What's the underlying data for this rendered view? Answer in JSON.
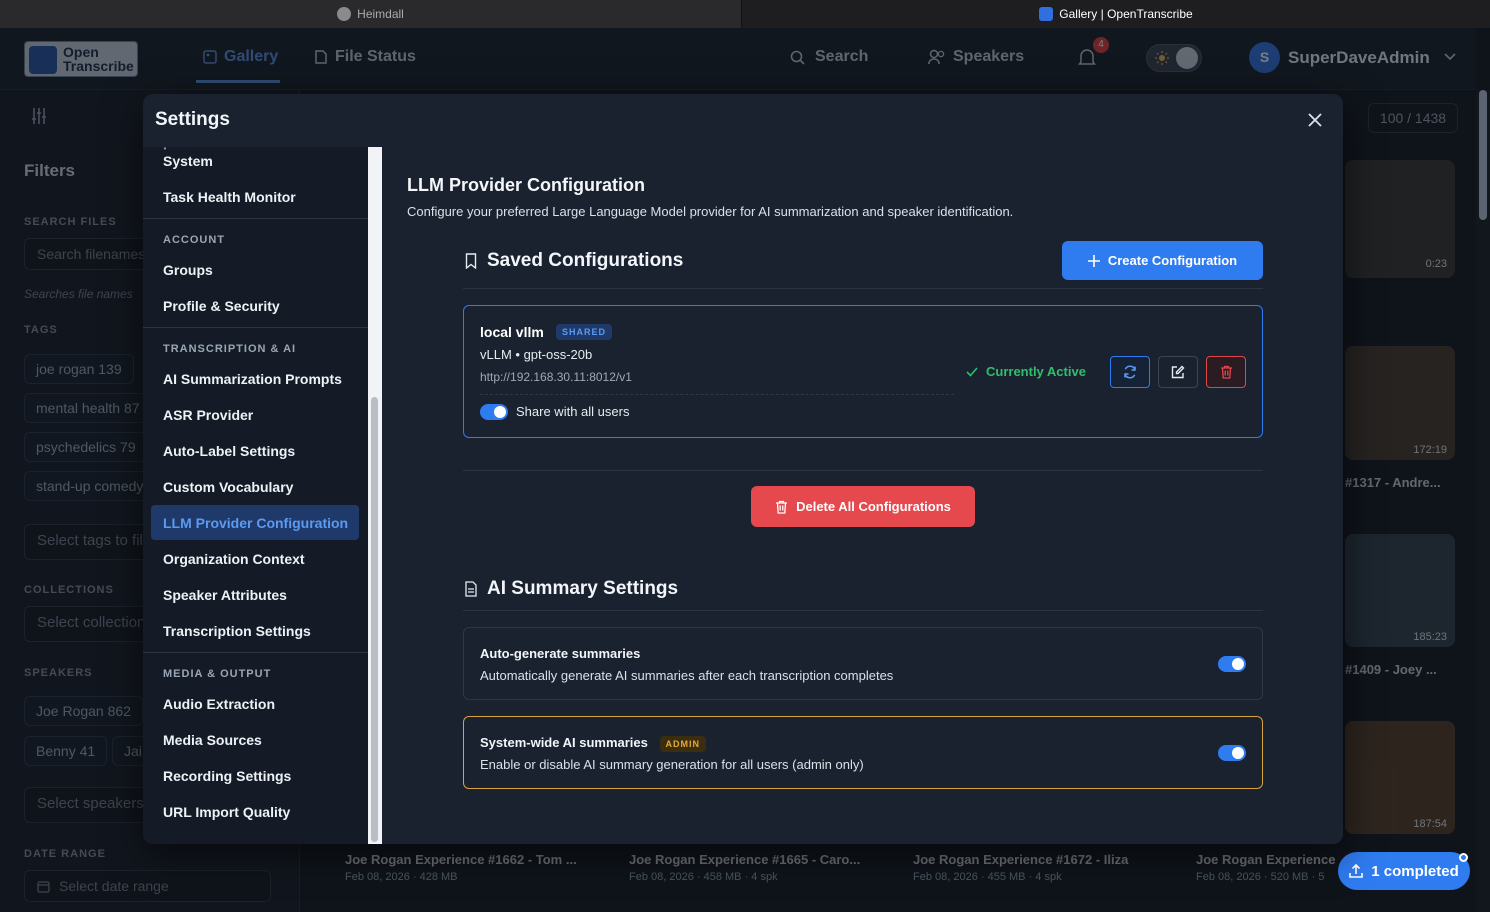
{
  "browser": {
    "tabs": [
      {
        "label": "Heimdall"
      },
      {
        "label": "Gallery | OpenTranscribe"
      }
    ]
  },
  "topnav": {
    "logo_text": "Open Transcribe",
    "gallery_label": "Gallery",
    "file_status_label": "File Status",
    "search_label": "Search",
    "speakers_label": "Speakers",
    "notification_count": "4",
    "avatar_initial": "S",
    "user_name": "SuperDaveAdmin"
  },
  "filters": {
    "title": "Filters",
    "search_files_label": "SEARCH FILES",
    "search_placeholder": "Search filenames",
    "search_hint": "Searches file names",
    "tags_label": "TAGS",
    "tags": [
      "joe rogan 139",
      "mental health 87",
      "psychedelics 79",
      "stand-up comedy"
    ],
    "select_tags": "Select tags to filter",
    "collections_label": "COLLECTIONS",
    "select_collections": "Select collections",
    "speakers_label": "SPEAKERS",
    "speakers": [
      "Joe Rogan 862",
      "Benny 41",
      "Jai"
    ],
    "select_speakers": "Select speakers",
    "date_range_label": "DATE RANGE",
    "date_placeholder": "Select date range"
  },
  "gallery": {
    "count": "100 / 1438",
    "thumbs": [
      {
        "duration": "0:23"
      },
      {
        "duration": "172:19",
        "title": "#1317 - Andre..."
      },
      {
        "duration": "185:23",
        "title": "#1409 - Joey ..."
      },
      {
        "duration": "187:54"
      }
    ],
    "bottom_items": [
      {
        "title": "Joe Rogan Experience #1662 - Tom ...",
        "meta": "Feb 08, 2026 · 428 MB"
      },
      {
        "title": "Joe Rogan Experience #1665 - Caro...",
        "meta": "Feb 08, 2026 · 458 MB · 4 spk"
      },
      {
        "title": "Joe Rogan Experience #1672 - Iliza",
        "meta": "Feb 08, 2026 · 455 MB · 4 spk"
      },
      {
        "title": "Joe Rogan Experience",
        "meta": "Feb 08, 2026 · 520 MB · 5"
      }
    ],
    "completed_label": "1 completed"
  },
  "settings": {
    "title": "Settings",
    "sidebar": {
      "top_items": [
        "System",
        "Task Health Monitor"
      ],
      "groups": [
        {
          "label": "ACCOUNT",
          "items": [
            "Groups",
            "Profile & Security"
          ]
        },
        {
          "label": "TRANSCRIPTION & AI",
          "items": [
            "AI Summarization Prompts",
            "ASR Provider",
            "Auto-Label Settings",
            "Custom Vocabulary",
            "LLM Provider Configuration",
            "Organization Context",
            "Speaker Attributes",
            "Transcription Settings"
          ]
        },
        {
          "label": "MEDIA & OUTPUT",
          "items": [
            "Audio Extraction",
            "Media Sources",
            "Recording Settings",
            "URL Import Quality"
          ]
        }
      ]
    },
    "content": {
      "title": "LLM Provider Configuration",
      "subtitle": "Configure your preferred Large Language Model provider for AI summarization and speaker identification.",
      "saved_title": "Saved Configurations",
      "create_label": "Create Configuration",
      "config": {
        "name": "local vllm",
        "badge": "SHARED",
        "model": "vLLM • gpt-oss-20b",
        "url": "http://192.168.30.11:8012/v1",
        "share_label": "Share with all users",
        "active_label": "Currently Active"
      },
      "delete_all_label": "Delete All Configurations",
      "summary_title": "AI Summary Settings",
      "auto": {
        "title": "Auto-generate summaries",
        "desc": "Automatically generate AI summaries after each transcription completes"
      },
      "system": {
        "title": "System-wide AI summaries",
        "badge": "ADMIN",
        "desc": "Enable or disable AI summary generation for all users (admin only)"
      }
    }
  },
  "colors": {
    "accent": "#2f7bf0",
    "danger": "#e5484d",
    "success": "#2fbf6a",
    "admin_border": "#d9a23a"
  }
}
